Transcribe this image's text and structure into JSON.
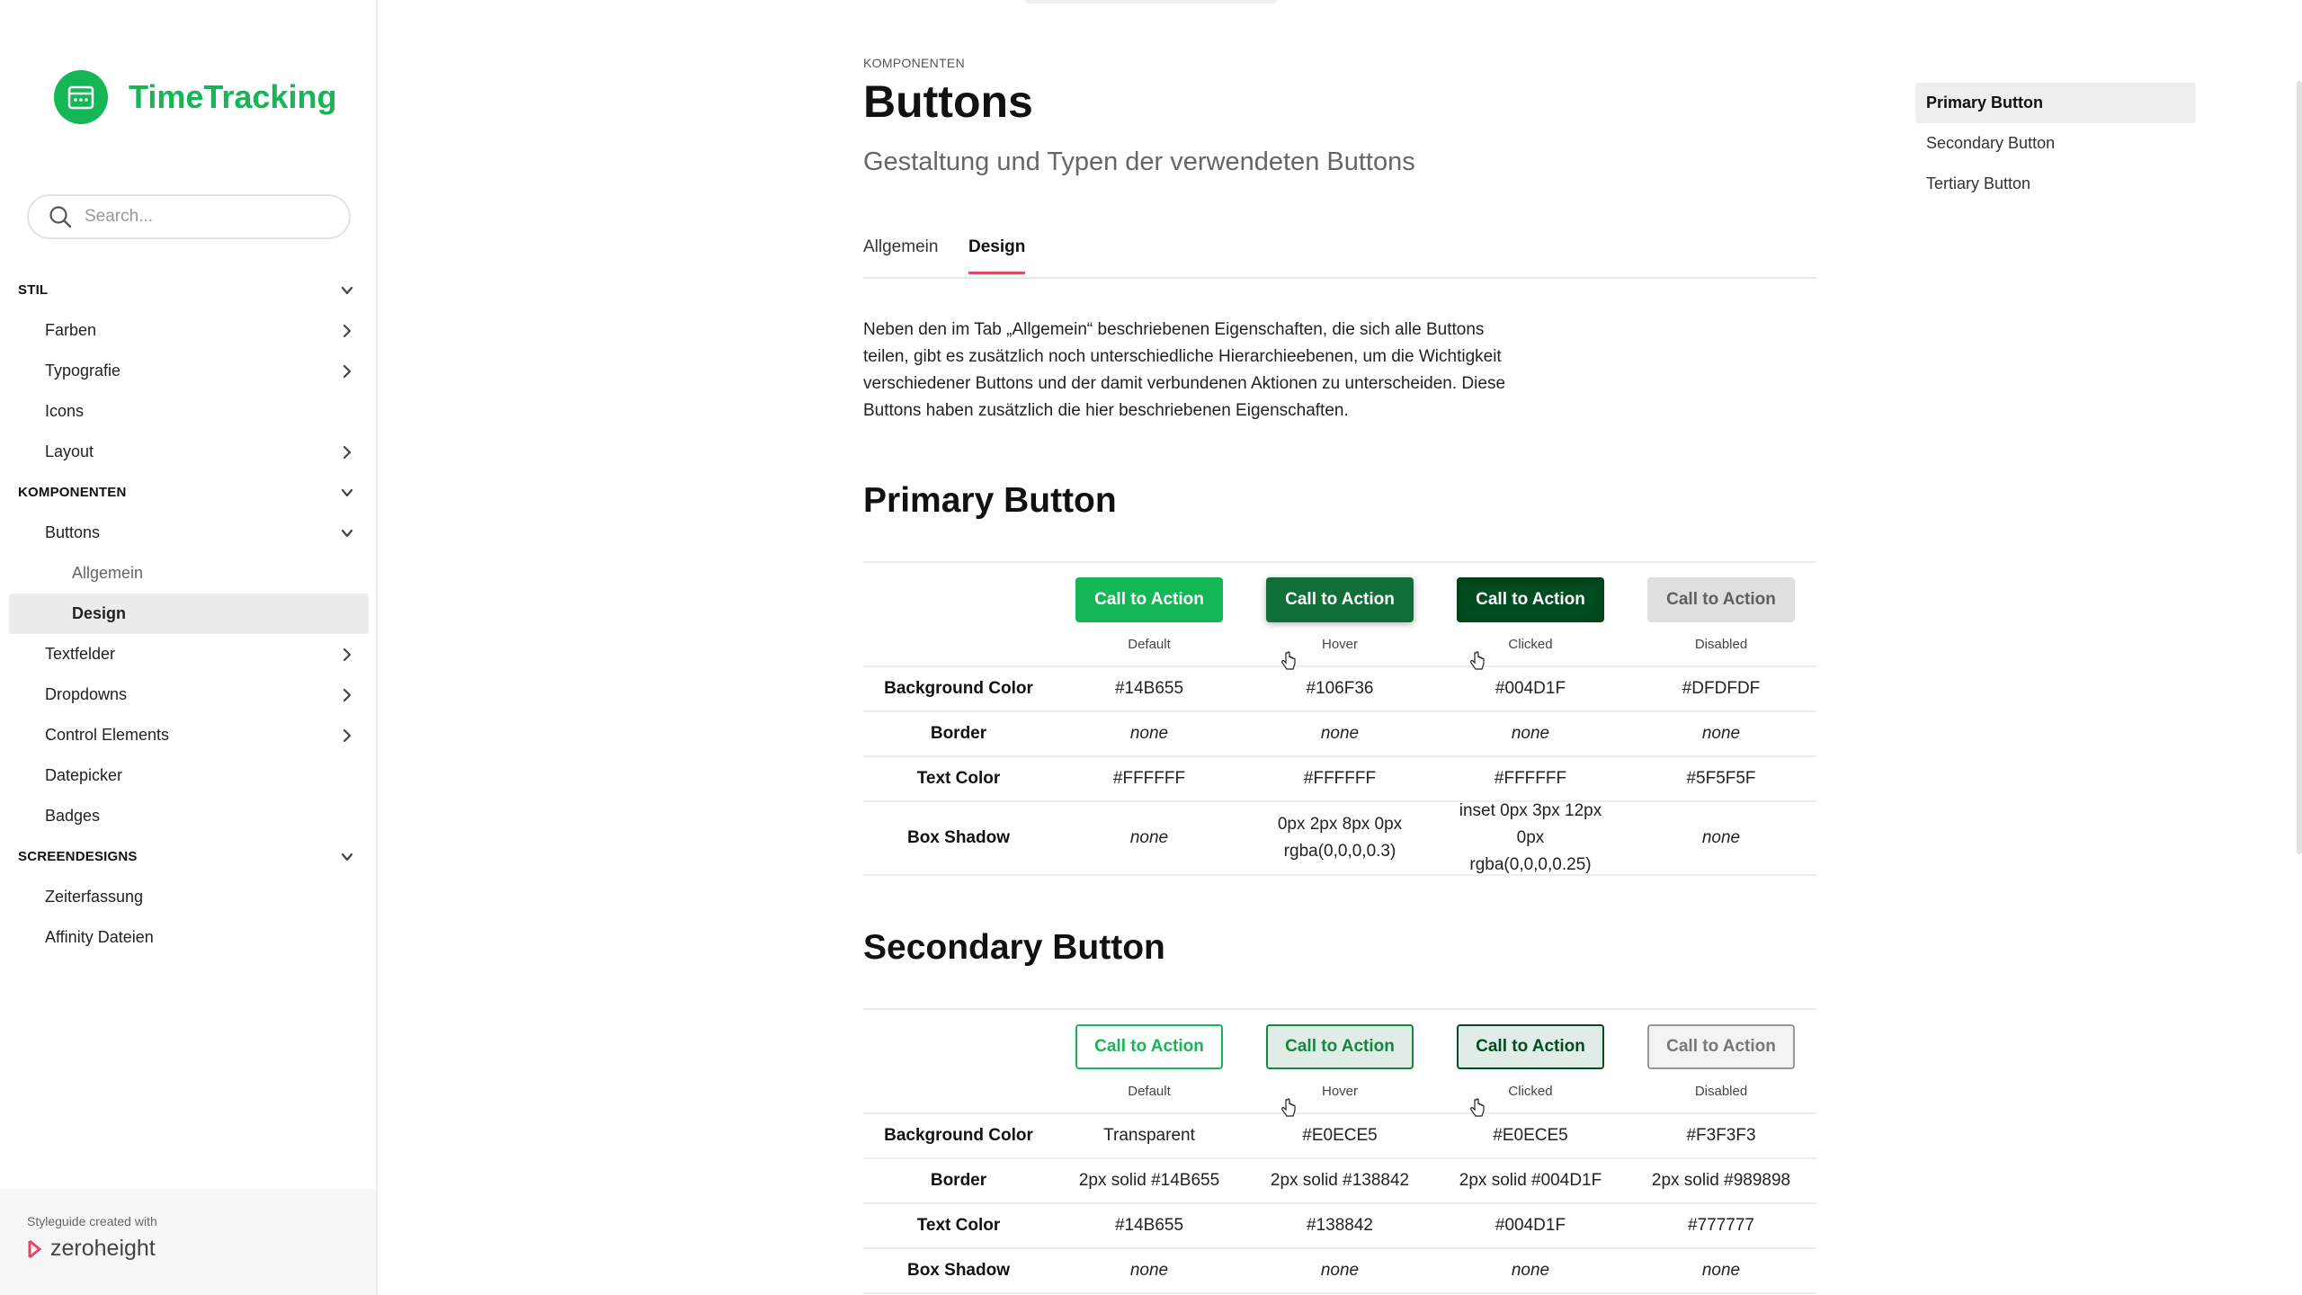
{
  "sidebar": {
    "app_name": "TimeTracking",
    "search_placeholder": "Search...",
    "items": [
      {
        "label": "STIL",
        "kind": "section",
        "chevron": "down"
      },
      {
        "label": "Farben",
        "kind": "l1",
        "chevron": "right"
      },
      {
        "label": "Typografie",
        "kind": "l1",
        "chevron": "right"
      },
      {
        "label": "Icons",
        "kind": "l1",
        "chevron": ""
      },
      {
        "label": "Layout",
        "kind": "l1",
        "chevron": "right"
      },
      {
        "label": "KOMPONENTEN",
        "kind": "section",
        "chevron": "down"
      },
      {
        "label": "Buttons",
        "kind": "l1",
        "chevron": "down"
      },
      {
        "label": "Allgemein",
        "kind": "l2",
        "chevron": ""
      },
      {
        "label": "Design",
        "kind": "l2",
        "chevron": "",
        "active": true
      },
      {
        "label": "Textfelder",
        "kind": "l1",
        "chevron": "right"
      },
      {
        "label": "Dropdowns",
        "kind": "l1",
        "chevron": "right"
      },
      {
        "label": "Control Elements",
        "kind": "l1",
        "chevron": "right"
      },
      {
        "label": "Datepicker",
        "kind": "l1",
        "chevron": ""
      },
      {
        "label": "Badges",
        "kind": "l1",
        "chevron": ""
      },
      {
        "label": "SCREENDESIGNS",
        "kind": "section",
        "chevron": "down"
      },
      {
        "label": "Zeiterfassung",
        "kind": "l1",
        "chevron": ""
      },
      {
        "label": "Affinity Dateien",
        "kind": "l1",
        "chevron": ""
      }
    ],
    "footer_text": "Styleguide created with",
    "footer_brand": "zeroheight"
  },
  "page": {
    "eyebrow": "KOMPONENTEN",
    "title": "Buttons",
    "subtitle": "Gestaltung und Typen der verwendeten Buttons",
    "tabs": [
      {
        "label": "Allgemein",
        "active": false
      },
      {
        "label": "Design",
        "active": true
      }
    ],
    "intro": "Neben den im Tab „Allgemein“ beschriebenen Eigenschaften, die sich alle Buttons teilen, gibt es zusätzlich noch unterschiedliche Hierarchieebenen, um die Wichtigkeit verschiedener Buttons und der damit verbundenen Aktionen zu unterscheiden. Diese Buttons haben zusätzlich die hier beschriebenen Eigenschaften."
  },
  "sections": [
    {
      "heading": "Primary Button",
      "button_label": "Call to Action",
      "states": [
        "Default",
        "Hover",
        "Clicked",
        "Disabled"
      ],
      "button_styles": [
        {
          "bg": "#14B655",
          "border": "none",
          "color": "#FFFFFF",
          "shadow": "none"
        },
        {
          "bg": "#106F36",
          "border": "none",
          "color": "#FFFFFF",
          "shadow": "0px 2px 8px 0px rgba(0,0,0,0.3)"
        },
        {
          "bg": "#004D1F",
          "border": "none",
          "color": "#FFFFFF",
          "shadow": "inset 0px 3px 12px 0px rgba(0,0,0,0.25)"
        },
        {
          "bg": "#DFDFDF",
          "border": "none",
          "color": "#5F5F5F",
          "shadow": "none"
        }
      ],
      "rows": [
        {
          "label": "Background Color",
          "values": [
            "#14B655",
            "#106F36",
            "#004D1F",
            "#DFDFDF"
          ],
          "italic": false,
          "tall": false
        },
        {
          "label": "Border",
          "values": [
            "none",
            "none",
            "none",
            "none"
          ],
          "italic": true,
          "tall": false
        },
        {
          "label": "Text Color",
          "values": [
            "#FFFFFF",
            "#FFFFFF",
            "#FFFFFF",
            "#5F5F5F"
          ],
          "italic": false,
          "tall": false
        },
        {
          "label": "Box Shadow",
          "values": [
            "none",
            "0px 2px 8px 0px rgba(0,0,0,0.3)",
            "inset 0px 3px 12px 0px rgba(0,0,0,0.25)",
            "none"
          ],
          "italic_mask": [
            true,
            false,
            false,
            true
          ],
          "tall": true
        }
      ]
    },
    {
      "heading": "Secondary Button",
      "button_label": "Call to Action",
      "states": [
        "Default",
        "Hover",
        "Clicked",
        "Disabled"
      ],
      "button_styles": [
        {
          "bg": "transparent",
          "border": "2px solid #14B655",
          "color": "#14B655",
          "shadow": "none"
        },
        {
          "bg": "#E0ECE5",
          "border": "2px solid #138842",
          "color": "#138842",
          "shadow": "none"
        },
        {
          "bg": "#E0ECE5",
          "border": "2px solid #004D1F",
          "color": "#004D1F",
          "shadow": "none"
        },
        {
          "bg": "#F3F3F3",
          "border": "2px solid #989898",
          "color": "#777777",
          "shadow": "none"
        }
      ],
      "rows": [
        {
          "label": "Background Color",
          "values": [
            "Transparent",
            "#E0ECE5",
            "#E0ECE5",
            "#F3F3F3"
          ],
          "italic": false,
          "tall": false
        },
        {
          "label": "Border",
          "values": [
            "2px solid #14B655",
            "2px solid #138842",
            "2px solid #004D1F",
            "2px solid #989898"
          ],
          "italic": false,
          "tall": false
        },
        {
          "label": "Text Color",
          "values": [
            "#14B655",
            "#138842",
            "#004D1F",
            "#777777"
          ],
          "italic": false,
          "tall": false
        },
        {
          "label": "Box Shadow",
          "values": [
            "none",
            "none",
            "none",
            "none"
          ],
          "italic": true,
          "tall": false
        }
      ]
    }
  ],
  "toc": [
    {
      "label": "Primary Button",
      "active": true
    },
    {
      "label": "Secondary Button",
      "active": false
    },
    {
      "label": "Tertiary Button",
      "active": false
    }
  ]
}
